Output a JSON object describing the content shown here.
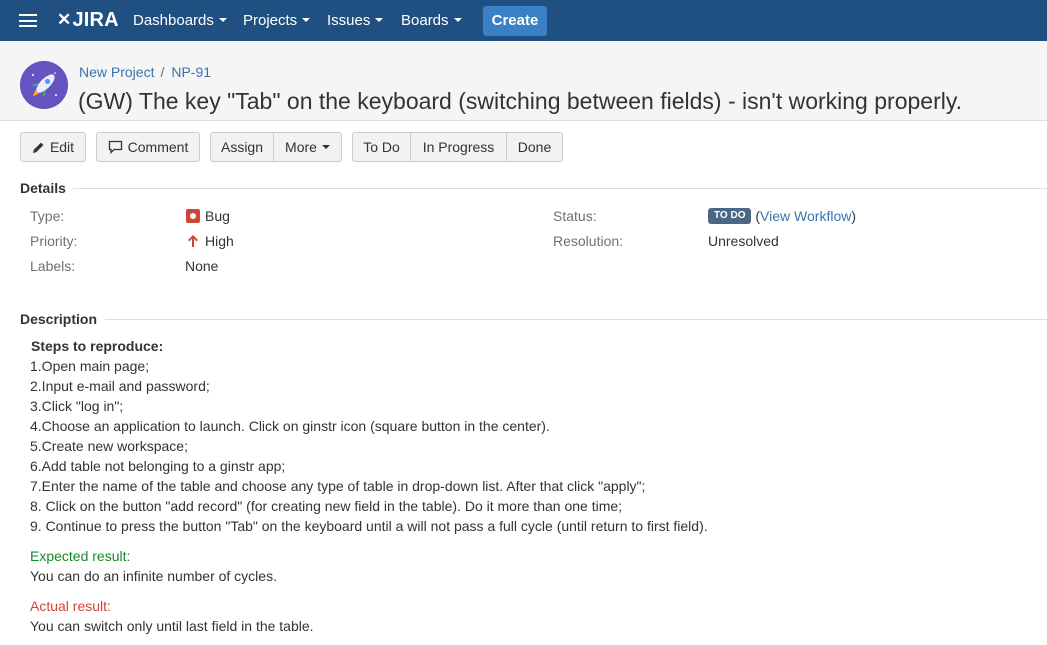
{
  "nav": {
    "logo_text": "JIRA",
    "items": [
      {
        "label": "Dashboards"
      },
      {
        "label": "Projects"
      },
      {
        "label": "Issues"
      },
      {
        "label": "Boards"
      }
    ],
    "create_label": "Create"
  },
  "header": {
    "project": "New Project",
    "separator": "/",
    "issue_key": "NP-91",
    "summary": "(GW) The key \"Tab\" on the keyboard (switching between fields) - isn't working properly."
  },
  "toolbar": {
    "edit": "Edit",
    "comment": "Comment",
    "assign": "Assign",
    "more": "More",
    "todo": "To Do",
    "in_progress": "In Progress",
    "done": "Done"
  },
  "details": {
    "title": "Details",
    "type_label": "Type:",
    "type_value": "Bug",
    "priority_label": "Priority:",
    "priority_value": "High",
    "labels_label": "Labels:",
    "labels_value": "None",
    "status_label": "Status:",
    "status_value": "TO DO",
    "view_workflow": "View Workflow",
    "resolution_label": "Resolution:",
    "resolution_value": "Unresolved",
    "colors": {
      "bug": "#d04437",
      "priority_high": "#d04437",
      "status": "#4a6785"
    }
  },
  "description": {
    "title": "Description",
    "steps_heading": "Steps to reproduce:",
    "steps": [
      "1.Open main page;",
      "2.Input e-mail and password;",
      "3.Click \"log in\";",
      "4.Choose an application to launch. Click on ginstr icon (square button in the center).",
      "5.Create new workspace;",
      "6.Add table not belonging to a ginstr app;",
      "7.Enter the name of the table and choose any type of table in drop-down list. After that click \"apply\";",
      "8. Click on the button \"add record\" (for creating new field in the table). Do it more than one time;",
      "9. Continue to press the button \"Tab\" on the keyboard until a will not pass a full cycle (until return to first field)."
    ],
    "expected_label": "Expected result:",
    "expected_text": "You can do an infinite number of cycles.",
    "actual_label": "Actual result:",
    "actual_text": "You can switch only until last field in the table."
  }
}
